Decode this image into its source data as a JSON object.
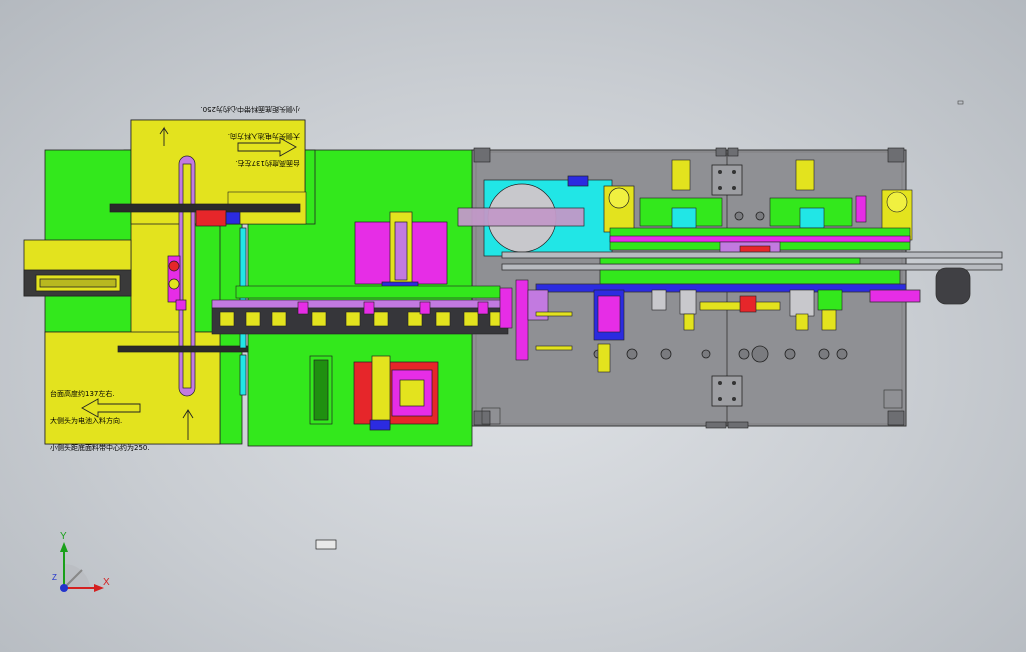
{
  "notes": {
    "bottom_left": [
      "台面高度约137左右.",
      "大侧头为电池入料方向.",
      "小侧头距底面料带中心约为250."
    ],
    "top_rotated": [
      "台面高度约137左右.",
      "大侧头为电池入料方向.",
      "小侧头距底面料带中心约为250."
    ]
  },
  "triad": {
    "x_label": "X",
    "y_label": "Y",
    "z_label": "Z"
  },
  "colors": {
    "background": "#c9cdd2",
    "green_table": "#33e81c",
    "yellow_table": "#e3e31e",
    "gray_table": "#8f9094",
    "cyan": "#21e6e6",
    "magenta": "#e62de6",
    "red": "#e6262a",
    "blue": "#2b2be0",
    "purple_rail": "#a069d6"
  },
  "icons": [
    "up-arrow-icon",
    "right-arrow-icon",
    "left-arrow-icon",
    "coordinate-triad-icon"
  ]
}
